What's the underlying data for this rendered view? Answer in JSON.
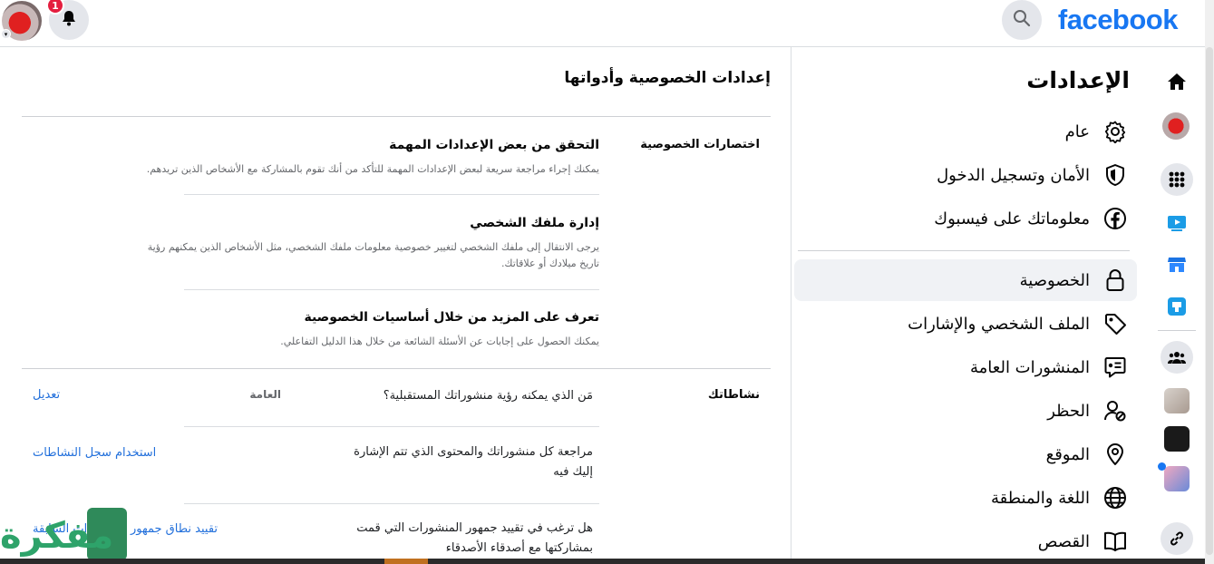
{
  "topbar": {
    "brand": "facebook",
    "notification_count": "1",
    "icons": [
      "search-icon",
      "bell-icon",
      "avatar"
    ]
  },
  "rail": {
    "icons": [
      "home-icon",
      "profile-avatar",
      "apps-grid-icon",
      "watch-icon",
      "marketplace-icon",
      "gaming-icon",
      "groups-icon",
      "group-thumb",
      "group-thumb",
      "group-thumb",
      "link-icon"
    ]
  },
  "settings": {
    "title": "الإعدادات",
    "items": [
      {
        "label": "عام",
        "icon": "gear-icon"
      },
      {
        "label": "الأمان وتسجيل الدخول",
        "icon": "shield-icon"
      },
      {
        "label": "معلوماتك على فيسبوك",
        "icon": "facebook-circle-icon"
      },
      {
        "label": "الخصوصية",
        "icon": "lock-icon"
      },
      {
        "label": "الملف الشخصي والإشارات",
        "icon": "tag-icon"
      },
      {
        "label": "المنشورات العامة",
        "icon": "public-posts-icon"
      },
      {
        "label": "الحظر",
        "icon": "block-user-icon"
      },
      {
        "label": "الموقع",
        "icon": "location-pin-icon"
      },
      {
        "label": "اللغة والمنطقة",
        "icon": "globe-icon"
      },
      {
        "label": "القصص",
        "icon": "book-icon"
      }
    ],
    "active_index": 3
  },
  "main": {
    "title": "إعدادات الخصوصية وأدواتها",
    "shortcuts": {
      "label": "اختصارات الخصوصية",
      "items": [
        {
          "title": "التحقق من بعض الإعدادات المهمة",
          "desc": "يمكنك إجراء مراجعة سريعة لبعض الإعدادات المهمة للتأكد من أنك تقوم بالمشاركة مع الأشخاص الذين تريدهم."
        },
        {
          "title": "إدارة ملفك الشخصي",
          "desc": "يرجى الانتقال إلى ملفك الشخصي لتغيير خصوصية معلومات ملفك الشخصي، مثل الأشخاص الذين يمكنهم رؤية تاريخ ميلادك أو علاقاتك."
        },
        {
          "title": "تعرف على المزيد من خلال أساسيات الخصوصية",
          "desc": "يمكنك الحصول على إجابات عن الأسئلة الشائعة من خلال هذا الدليل التفاعلي."
        }
      ]
    },
    "activity": {
      "label": "نشاطاتك",
      "rows": [
        {
          "question": "مَن الذي يمكنه رؤية منشوراتك المستقبلية؟",
          "value": "العامة",
          "link": "تعديل"
        },
        {
          "question": "مراجعة كل منشوراتك والمحتوى الذي تتم الإشارة إليك فيه",
          "value": "",
          "link": "استخدام سجل النشاطات"
        },
        {
          "question": "هل ترغب في تقييد جمهور المنشورات التي قمت بمشاركتها مع أصدقاء الأصدقاء",
          "value": "",
          "link": "تقييد نطاق جمهور المنشورات السابقة"
        }
      ]
    }
  },
  "watermark": {
    "text": "مفكرة"
  },
  "colors": {
    "brand": "#1877f2",
    "link": "#216fdb",
    "badge": "#e41e3f",
    "active_bg": "#f0f2f5"
  }
}
